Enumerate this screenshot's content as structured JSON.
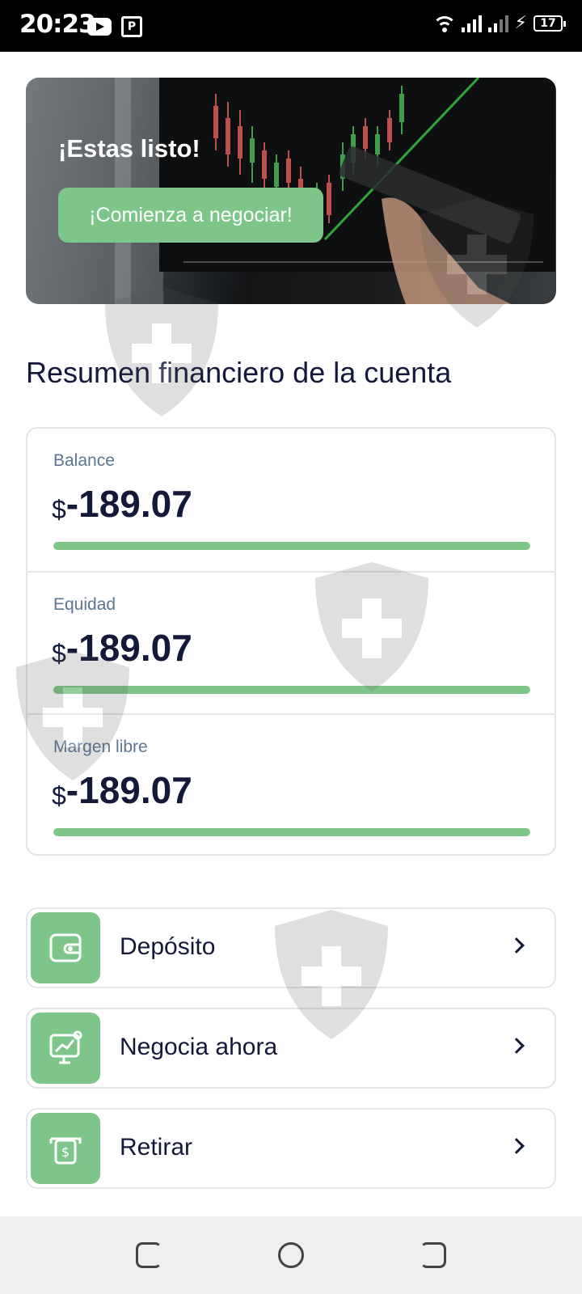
{
  "status_bar": {
    "time": "20:23",
    "icons": [
      "youtube-icon",
      "picture-icon",
      "wifi-icon",
      "signal-icon",
      "signal-icon",
      "charging-icon",
      "battery-icon"
    ],
    "battery_level": "17"
  },
  "banner": {
    "title": "¡Estas listo!",
    "cta_label": "¡Comienza a negociar!"
  },
  "summary": {
    "title": "Resumen financiero de la cuenta",
    "currency_symbol": "$",
    "metrics": [
      {
        "label": "Balance",
        "value": "-189.07",
        "progress": 1.0
      },
      {
        "label": "Equidad",
        "value": "-189.07",
        "progress": 1.0
      },
      {
        "label": "Margen libre",
        "value": "-189.07",
        "progress": 1.0
      }
    ]
  },
  "actions": [
    {
      "label": "Depósito",
      "icon": "wallet-icon"
    },
    {
      "label": "Negocia ahora",
      "icon": "trade-chart-icon"
    },
    {
      "label": "Retirar",
      "icon": "withdraw-cash-icon"
    }
  ],
  "nav": {
    "buttons": [
      "recent-apps-icon",
      "home-icon",
      "back-icon"
    ]
  },
  "colors": {
    "accent": "#7ec58a",
    "text_dark": "#14193a",
    "label": "#5c7592",
    "border": "#e3e5ea",
    "status_bar": "#000000",
    "nav_bar": "#efefef"
  }
}
